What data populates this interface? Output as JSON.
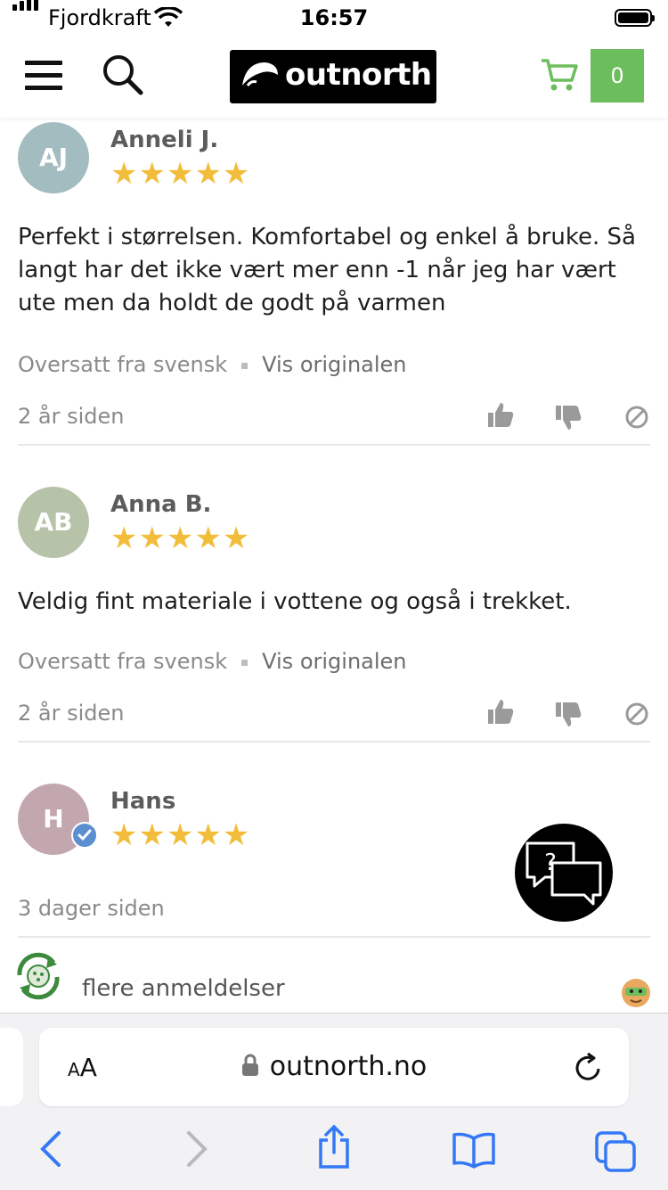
{
  "status_bar": {
    "carrier": "Fjordkraft",
    "time": "16:57"
  },
  "header": {
    "logo_text": "outnorth",
    "cart_count": "0",
    "icons": {
      "menu": "hamburger-menu-icon",
      "search": "search-icon",
      "cart": "shopping-cart-icon"
    },
    "colors": {
      "cart_badge": "#6cbe5c",
      "logo_bg": "#000000"
    }
  },
  "reviews": [
    {
      "initials": "AJ",
      "name": "Anneli J.",
      "stars": "★★★★★",
      "rating": 5,
      "text": "Perfekt i størrelsen. Komfortabel og enkel å bruke. Så langt har det ikke vært mer enn -1 når jeg har vært ute men da holdt de godt på varmen",
      "translated_label": "Oversatt fra svensk",
      "original_link": "Vis originalen",
      "time": "2 år siden",
      "avatar_color": "#a3bcc0"
    },
    {
      "initials": "AB",
      "name": "Anna B.",
      "stars": "★★★★★",
      "rating": 5,
      "text": "Veldig fint materiale i vottene og også i trekket.",
      "translated_label": "Oversatt fra svensk",
      "original_link": "Vis originalen",
      "time": "2 år siden",
      "avatar_color": "#b6c3a8"
    },
    {
      "initials": "H",
      "name": "Hans",
      "stars": "★★★★★",
      "rating": 5,
      "verified": true,
      "time": "3 dager siden",
      "avatar_color": "#c2a8ae"
    }
  ],
  "more_reviews": "flere anmeldelser",
  "star_color": "#f2bd3b",
  "browser": {
    "aa_label": "AA",
    "url": "outnorth.no"
  }
}
